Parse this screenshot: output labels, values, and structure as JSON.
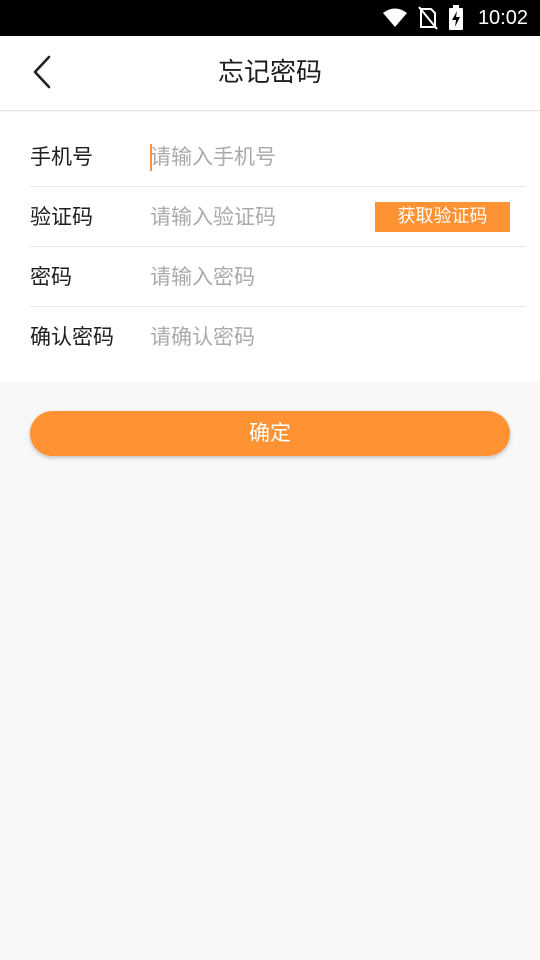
{
  "status_bar": {
    "time": "10:02",
    "icons": [
      "wifi-icon",
      "no-sim-icon",
      "battery-charging-icon"
    ]
  },
  "header": {
    "title": "忘记密码",
    "back_icon": "chevron-left-icon"
  },
  "form": {
    "phone": {
      "label": "手机号",
      "placeholder": "请输入手机号",
      "value": ""
    },
    "code": {
      "label": "验证码",
      "placeholder": "请输入验证码",
      "value": "",
      "button_label": "获取验证码"
    },
    "password": {
      "label": "密码",
      "placeholder": "请输入密码",
      "value": ""
    },
    "confirm_password": {
      "label": "确认密码",
      "placeholder": "请确认密码",
      "value": ""
    }
  },
  "confirm_button": {
    "label": "确定"
  },
  "colors": {
    "accent": "#ff9232",
    "background": "#f8f8f8",
    "surface": "#ffffff",
    "divider": "#e6e6e6",
    "placeholder": "#aaaaaa"
  }
}
